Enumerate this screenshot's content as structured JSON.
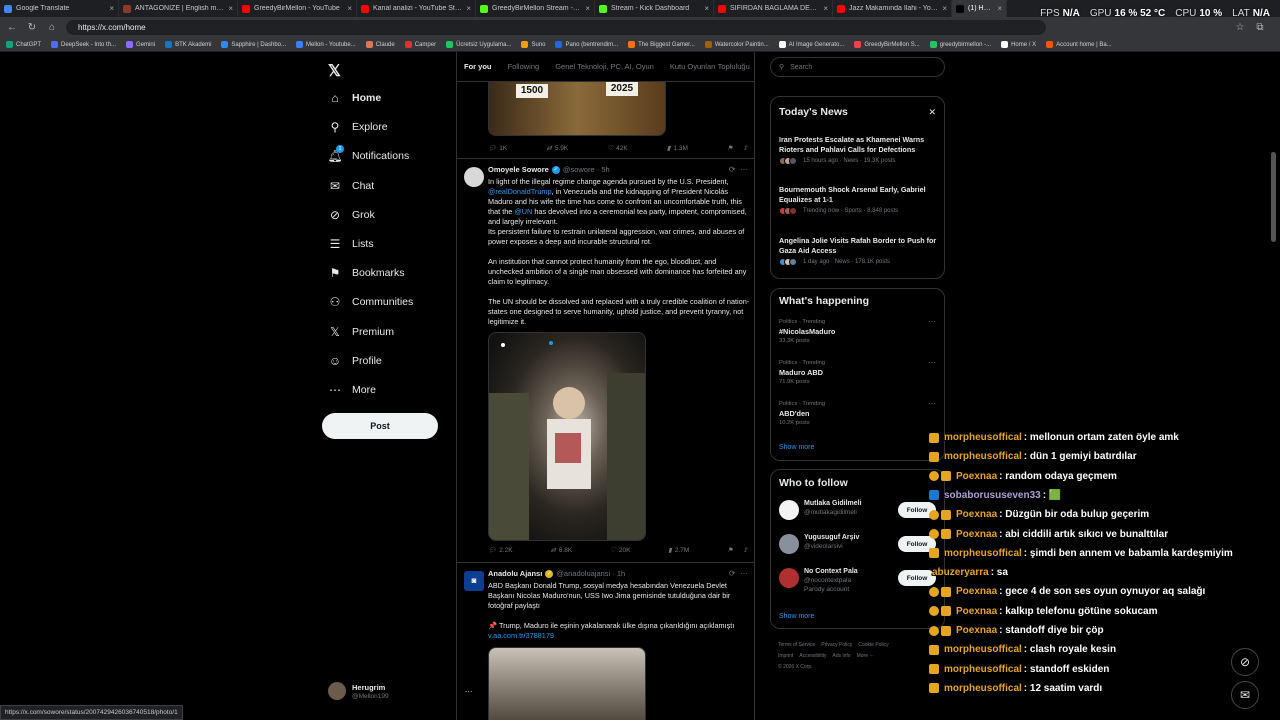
{
  "tabs": [
    {
      "label": "Google Translate",
      "color": "#4285f4"
    },
    {
      "label": "ANTAGONIZE | English meaning",
      "color": "#8a3b2a"
    },
    {
      "label": "GreedyBirMellon - YouTube",
      "color": "#ff0000"
    },
    {
      "label": "Kanal analizi - YouTube Studio",
      "color": "#ff0000"
    },
    {
      "label": "GreedyBirMellon Stream - Watch",
      "color": "#53fc18"
    },
    {
      "label": "Stream - Kick Dashboard",
      "color": "#53fc18"
    },
    {
      "label": "SIFIRDAN BAĞLAMA DERSİ 7 | BU...",
      "color": "#ff0000"
    },
    {
      "label": "Jazz Makamında İlahi - YouTube",
      "color": "#ff0000"
    },
    {
      "label": "(1) Home / X",
      "color": "#000000",
      "active": true
    }
  ],
  "metrics": {
    "fps_label": "FPS",
    "fps": "N/A",
    "gpu_label": "GPU",
    "gpu": "16 % 52 °C",
    "cpu_label": "CPU",
    "cpu": "10 %",
    "lat_label": "LAT",
    "lat": "N/A"
  },
  "address": {
    "url": "https://x.com/home"
  },
  "bookmarks": [
    {
      "label": "ChatGPT",
      "color": "#10a37f"
    },
    {
      "label": "DeepSeek - Into th...",
      "color": "#4d6bfe"
    },
    {
      "label": "Gemini",
      "color": "#8e6bff"
    },
    {
      "label": "BTK Akademi",
      "color": "#1b75bc"
    },
    {
      "label": "Sapphire | Dashbo...",
      "color": "#2a8bf2"
    },
    {
      "label": "Mellon - Youtube...",
      "color": "#3b82f6"
    },
    {
      "label": "Claude",
      "color": "#d97757"
    },
    {
      "label": "Camper",
      "color": "#e03131"
    },
    {
      "label": "Ücretsiz Uygulama...",
      "color": "#22c55e"
    },
    {
      "label": "Suno",
      "color": "#f59e0b"
    },
    {
      "label": "Pano (bentrendim...",
      "color": "#2563eb"
    },
    {
      "label": "The Biggest Gamer...",
      "color": "#f97316"
    },
    {
      "label": "Watercolor Paintin...",
      "color": "#a16207"
    },
    {
      "label": "AI Image Generato...",
      "color": "#ffffff"
    },
    {
      "label": "GreedyBirMellon S...",
      "color": "#ef4444"
    },
    {
      "label": "greedybirmellon -...",
      "color": "#22c55e"
    },
    {
      "label": "Home / X",
      "color": "#ffffff"
    },
    {
      "label": "Account home | Ba...",
      "color": "#ea580c"
    }
  ],
  "nav": [
    {
      "label": "Home",
      "icon": "home-icon",
      "glyph": "⌂"
    },
    {
      "label": "Explore",
      "icon": "search-icon",
      "glyph": "⚲"
    },
    {
      "label": "Notifications",
      "icon": "bell-icon",
      "glyph": "🔔︎"
    },
    {
      "label": "Chat",
      "icon": "mail-icon",
      "glyph": "✉"
    },
    {
      "label": "Grok",
      "icon": "grok-icon",
      "glyph": "⊘"
    },
    {
      "label": "Lists",
      "icon": "list-icon",
      "glyph": "☰"
    },
    {
      "label": "Bookmarks",
      "icon": "bookmark-icon",
      "glyph": "⚑"
    },
    {
      "label": "Communities",
      "icon": "people-icon",
      "glyph": "⚇"
    },
    {
      "label": "Premium",
      "icon": "x-logo-icon",
      "glyph": "𝕏"
    },
    {
      "label": "Profile",
      "icon": "person-icon",
      "glyph": "☺"
    },
    {
      "label": "More",
      "icon": "more-circle-icon",
      "glyph": "⋯"
    }
  ],
  "notif_count": "1",
  "post_button": "Post",
  "account": {
    "name": "Herugrim",
    "handle": "@Mellon199"
  },
  "timeline_tabs": [
    "For you",
    "Following",
    "Genel Teknoloji, PC, AI, Oyun",
    "Kutu Oyunları Topluluğu"
  ],
  "prev_post": {
    "img_left": "1500",
    "img_right": "2025",
    "replies": "1K",
    "reposts": "5.9K",
    "likes": "42K",
    "views": "1.3M"
  },
  "post1": {
    "name": "Omoyele Sowore",
    "handle": "@sowore · 5h",
    "text_a": "In light of the illegal regime change agenda pursued by the U.S. President, ",
    "mention1": "@realDonaldTrump",
    "text_b": ", in Venezuela and the kidnapping of President Nicolás Maduro and his wife the time has come to confront an uncomfortable truth, this that the ",
    "mention2": "@UN",
    "text_c": " has devolved into a ceremonial tea party, impotent, compromised, and largely irrelevant.\nIts persistent failure to restrain unilateral aggression, war crimes, and abuses of power exposes a deep and incurable structural rot.\n\nAn institution that cannot protect humanity from the ego, bloodlust, and unchecked ambition of a single man obsessed with dominance has forfeited any claim to legitimacy.\n\nThe UN should be dissolved and replaced with a truly credible coalition of nation-states one designed to serve humanity, uphold justice, and prevent tyranny, not legitimize it.",
    "replies": "2.2K",
    "reposts": "6.8K",
    "likes": "20K",
    "views": "2.7M"
  },
  "post2": {
    "name": "Anadolu Ajansı",
    "handle": "@anadoluajansi · 1h",
    "text": "ABD Başkanı Donald Trump, sosyal medya hesabından Venezuela Devlet Başkanı Nicolas Maduro'nun, USS Iwo Jima gemisinde tutulduğuna dair bir fotoğraf paylaştı\n\n📌 Trump, Maduro ile eşinin yakalanarak ülke dışına çıkarıldığını açıklamıştı",
    "link": "v.aa.com.tr/3788179"
  },
  "search_placeholder": "Search",
  "news": {
    "title": "Today's News",
    "items": [
      {
        "headline": "Iran Protests Escalate as Khamenei Warns Rioters and Pahlavi Calls for Defections",
        "meta": "15 hours ago · News · 19.3K posts"
      },
      {
        "headline": "Bournemouth Shock Arsenal Early, Gabriel Equalizes at 1-1",
        "meta": "Trending now · Sports · 8,848 posts"
      },
      {
        "headline": "Angelina Jolie Visits Rafah Border to Push for Gaza Aid Access",
        "meta": "1 day ago · News · 178.1K posts"
      }
    ]
  },
  "happening": {
    "title": "What's happening",
    "items": [
      {
        "context": "Politics · Trending",
        "topic": "#NicolasMaduro",
        "posts": "33.3K posts"
      },
      {
        "context": "Politics · Trending",
        "topic": "Maduro ABD",
        "posts": "71.9K posts"
      },
      {
        "context": "Politics · Trending",
        "topic": "ABD'den",
        "posts": "10.2K posts"
      }
    ],
    "show_more": "Show more"
  },
  "follow": {
    "title": "Who to follow",
    "items": [
      {
        "name": "Mutlaka Gidilmeli",
        "handle": "@mutlakagidilmeli",
        "extra": ""
      },
      {
        "name": "Yugusuguf Arşiv",
        "handle": "@videolarsivi",
        "extra": ""
      },
      {
        "name": "No Context Pala",
        "handle": "@nocontextpala",
        "extra": "Parody account"
      }
    ],
    "button": "Follow",
    "show_more": "Show more"
  },
  "footer": [
    "Terms of Service",
    "Privacy Policy",
    "Cookie Policy",
    "Imprint",
    "Accessibility",
    "Ads info",
    "More ···",
    "© 2026 X Corp."
  ],
  "chat": [
    {
      "user": "morpheusoffical",
      "color": "#e5a520",
      "msg": ": mellonun ortam zaten öyle amk",
      "badges": "b"
    },
    {
      "user": "morpheusoffical",
      "color": "#e5a520",
      "msg": ": dün 1 gemiyi batırdılar",
      "badges": "b"
    },
    {
      "user": "Poexnaa",
      "color": "#e5a520",
      "msg": ": random odaya geçmem",
      "badges": "ob"
    },
    {
      "user": "sobaborususeven33",
      "color": "#b39ddb",
      "msg": ": 🟩",
      "badges": "x"
    },
    {
      "user": "Poexnaa",
      "color": "#e5a520",
      "msg": ": Düzgün bir oda bulup geçerim",
      "badges": "ob"
    },
    {
      "user": "Poexnaa",
      "color": "#e5a520",
      "msg": ": abi ciddili artık sıkıcı ve bunalttılar",
      "badges": "ob"
    },
    {
      "user": "morpheusoffical",
      "color": "#e5a520",
      "msg": ": şimdi ben annem ve babamla kardeşmiyim",
      "badges": "b"
    },
    {
      "user": "abuzeryarra",
      "color": "#e5a520",
      "msg": ": sa",
      "badges": ""
    },
    {
      "user": "Poexnaa",
      "color": "#e5a520",
      "msg": ": gece 4 de son ses oyun oynuyor aq salağı",
      "badges": "ob"
    },
    {
      "user": "Poexnaa",
      "color": "#e5a520",
      "msg": ": kalkıp telefonu götüne sokucam",
      "badges": "ob"
    },
    {
      "user": "Poexnaa",
      "color": "#e5a520",
      "msg": ": standoff diye bir çöp",
      "badges": "ob"
    },
    {
      "user": "morpheusoffical",
      "color": "#e5a520",
      "msg": ": clash royale kesin",
      "badges": "b"
    },
    {
      "user": "morpheusoffical",
      "color": "#e5a520",
      "msg": ": standoff eskiden",
      "badges": "b"
    },
    {
      "user": "morpheusoffical",
      "color": "#e5a520",
      "msg": ": 12 saatim vardı",
      "badges": "b"
    }
  ],
  "status_url": "https://x.com/sowore/status/2007429426036740518/photo/1",
  "colors": {
    "accent": "#1d9bf0",
    "bg": "#000000",
    "muted": "#71767b"
  }
}
